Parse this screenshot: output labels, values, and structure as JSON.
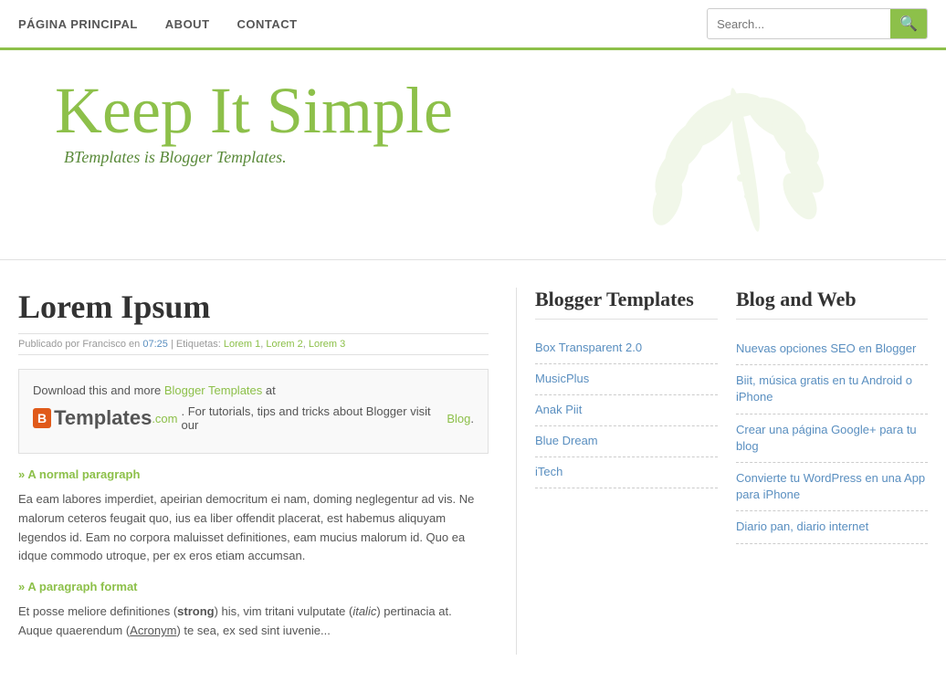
{
  "navbar": {
    "links": [
      {
        "label": "PÁGINA PRINCIPAL",
        "href": "#"
      },
      {
        "label": "ABOUT",
        "href": "#"
      },
      {
        "label": "CONTACT",
        "href": "#"
      }
    ],
    "search_placeholder": "Search...",
    "search_icon": "🔍"
  },
  "header": {
    "site_title": "Keep It Simple",
    "site_subtitle": "BTemplates is Blogger Templates."
  },
  "post": {
    "title": "Lorem Ipsum",
    "meta_published": "Publicado por Francisco en",
    "meta_time": "07:25",
    "meta_labels_prefix": "| Etiquetas:",
    "meta_labels": [
      "Lorem 1",
      "Lorem 2",
      "Lorem 3"
    ],
    "download_intro": "Download this and more",
    "download_link_text": "Blogger Templates",
    "download_after": "at",
    "logo_icon": "B",
    "logo_main": "Templates",
    "logo_dotcom": ".com",
    "logo_description": ". For tutorials, tips and tricks about Blogger visit our",
    "blog_link": "Blog",
    "paragraph_a_heading": "» A normal paragraph",
    "paragraph_a": "Ea eam labores imperdiet, apeirian democritum ei nam, doming neglegentur ad vis. Ne malorum ceteros feugait quo, ius ea liber offendit placerat, est habemus aliquyam legendos id. Eam no corpora maluisset definitiones, eam mucius malorum id. Quo ea idque commodo utroque, per ex eros etiam accumsan.",
    "paragraph_b_heading": "» A paragraph format",
    "paragraph_b": "Et posse meliore definitiones (strong) his, vim tritani vulputate (italic) pertinacia at. Auque quaerendum (Acronym) te sea, ex sed sint iuvenie..."
  },
  "sidebar_blogger": {
    "title": "Blogger Templates",
    "items": [
      {
        "label": "Box Transparent 2.0",
        "href": "#"
      },
      {
        "label": "MusicPlus",
        "href": "#"
      },
      {
        "label": "Anak Piit",
        "href": "#"
      },
      {
        "label": "Blue Dream",
        "href": "#"
      },
      {
        "label": "iTech",
        "href": "#"
      }
    ]
  },
  "sidebar_blog": {
    "title": "Blog and Web",
    "items": [
      {
        "label": "Nuevas opciones SEO en Blogger",
        "href": "#"
      },
      {
        "label": "Biit, música gratis en tu Android o iPhone",
        "href": "#"
      },
      {
        "label": "Crear una página Google+ para tu blog",
        "href": "#"
      },
      {
        "label": "Convierte tu WordPress en una App para iPhone",
        "href": "#"
      },
      {
        "label": "Diario pan, diario internet",
        "href": "#"
      }
    ]
  }
}
